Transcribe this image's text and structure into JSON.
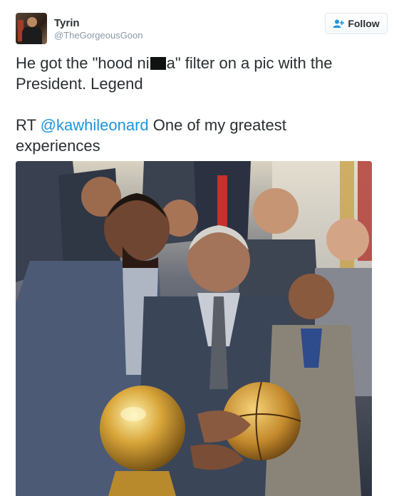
{
  "user": {
    "display_name": "Tyrin",
    "handle": "@TheGorgeousGoon",
    "avatar_icon": "profile-photo"
  },
  "follow_button": {
    "label": "Follow",
    "icon": "add-user-icon"
  },
  "tweet": {
    "line1_before": "He got the \"hood ni",
    "line1_after": "a\" filter on a pic with the",
    "line2": "President. Legend",
    "rt_prefix": "RT ",
    "mention": "@kawhileonard",
    "rt_text": " One of my greatest",
    "rt_line2": "experiences"
  },
  "media": {
    "description_icon": "photo"
  },
  "colors": {
    "link": "#1b95e0",
    "text": "#292f33",
    "muted": "#8899a6",
    "border": "#e1e8ed"
  }
}
